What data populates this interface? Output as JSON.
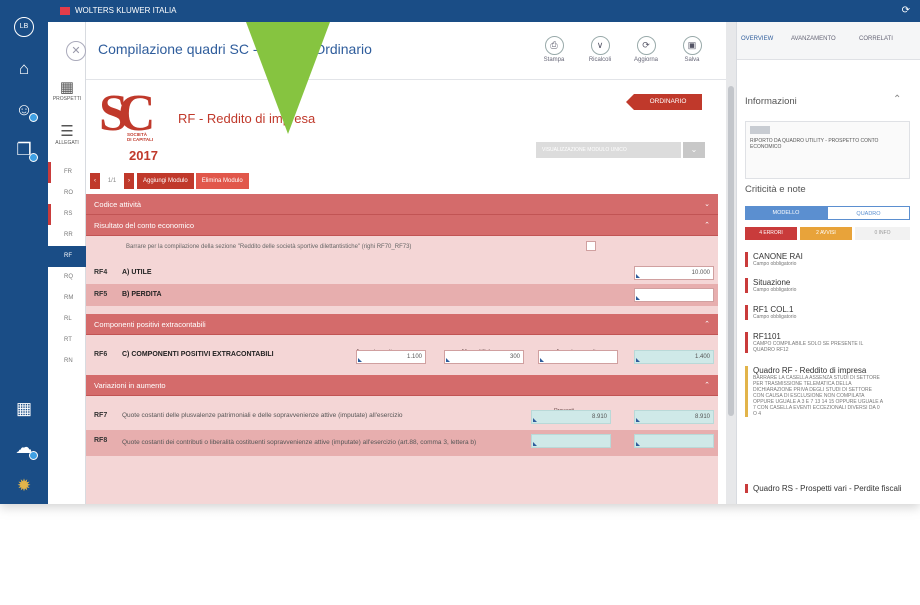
{
  "topbar": {
    "brand": "WOLTERS KLUWER ITALIA"
  },
  "rail": {
    "user_initials": "LB"
  },
  "subnav": {
    "prospetti": "PROSPETTI",
    "allegati": "ALLEGATI",
    "items": [
      "FR",
      "RO",
      "RS",
      "RR",
      "RF",
      "RQ",
      "RM",
      "RL",
      "RT",
      "RN"
    ]
  },
  "header": {
    "title": "Compilazione quadri SC - Modello Ordinario",
    "tools": [
      {
        "label": "Stampa",
        "icon": "print-icon"
      },
      {
        "label": "Ricalcoli",
        "icon": "refresh-icon"
      },
      {
        "label": "Aggiorna",
        "icon": "update-icon"
      },
      {
        "label": "Salva",
        "icon": "save-icon"
      }
    ]
  },
  "form": {
    "logo": {
      "letters": "SC",
      "sub1": "SOCIETÀ",
      "sub2": "DI CAPITALI",
      "year": "2017"
    },
    "title": "RF - Reddito di impresa",
    "badge": "ORDINARIO",
    "select_placeholder": "VISUALIZZAZIONE MODULO UNICO",
    "pager": {
      "page": "1/1",
      "add_tab": "Aggiungi Modulo",
      "del_tab": "Elimina Modulo"
    },
    "sections": [
      "Codice attività",
      "Risultato del conto economico",
      "Componenti positivi extracontabili",
      "Variazioni in aumento"
    ],
    "checkbox_text": "Barrare per la compilazione della sezione \"Reddito delle società sportive dilettantistiche\" (righi RF70_RF73)",
    "rows": [
      {
        "code": "RF4",
        "label": "A) UTILE",
        "value": "10.000"
      },
      {
        "code": "RF5",
        "label": "B) PERDITA",
        "value": ""
      }
    ],
    "col_headers": [
      "Ammortamenti",
      "Altre rettifiche",
      "Accantonamenti"
    ],
    "rf6": {
      "code": "RF6",
      "label": "C) COMPONENTI POSITIVI EXTRACONTABILI",
      "v1": "1.100",
      "v2": "300",
      "v3": "",
      "total": "1.400"
    },
    "proventi_label": "Proventi",
    "rf7": {
      "code": "RF7",
      "label": "Quote costanti delle plusvalenze patrimoniali e delle sopravvenienze attive (imputate) all'esercizio",
      "v1": "8.910",
      "v2": "8.910"
    },
    "rf8": {
      "code": "RF8",
      "label": "Quote costanti dei contributi o liberalità costituenti sopravvenienze attive (imputate) all'esercizio (art.88, comma 3, lettera b)",
      "v1": "",
      "v2": ""
    }
  },
  "right": {
    "tabs": [
      "OVERVIEW",
      "AVANZAMENTO",
      "CORRELATI"
    ],
    "info_title": "Informazioni",
    "info_text": "RIPORTO DA QUADRO UTILITY - PROSPETTO CONTO ECONOMICO",
    "crit_title": "Criticità e note",
    "seg": [
      "MODELLO",
      "QUADRO"
    ],
    "badges": [
      "4 ERRORI",
      "2 AVVISI",
      "0 INFO"
    ],
    "crit_items": [
      {
        "title": "CANONE RAI",
        "sub": "Campo obbligatorio",
        "color": "red"
      },
      {
        "title": "Situazione",
        "sub": "Campo obbligatorio",
        "color": "red"
      },
      {
        "title": "RF1 COL.1",
        "sub": "Campo obbligatorio",
        "color": "red"
      },
      {
        "title": "RF1101",
        "sub": "CAMPO COMPILABILE SOLO SE PRESENTE IL QUADRO RF12",
        "color": "red"
      },
      {
        "title": "Quadro RF - Reddito di impresa",
        "sub": "BARRARE LA CASELLA ASSENZA STUDI DI SETTORE PER TRASMISSIONE TELEMATICA DELLA DICHIARAZIONE PRIVA DEGLI STUDI DI SETTORE CON CAUSA DI ESCLUSIONE NON COMPILATA OPPURE UGUALE A 3 E 7 13 14 15 OPPURE UGUALE A 7 CON CASELLA EVENTI ECCEZIONALI DIVERSI DA 0 O 4",
        "color": "yellow"
      },
      {
        "title": "Quadro RS - Prospetti vari - Perdite fiscali",
        "sub": "",
        "color": "red"
      }
    ]
  }
}
